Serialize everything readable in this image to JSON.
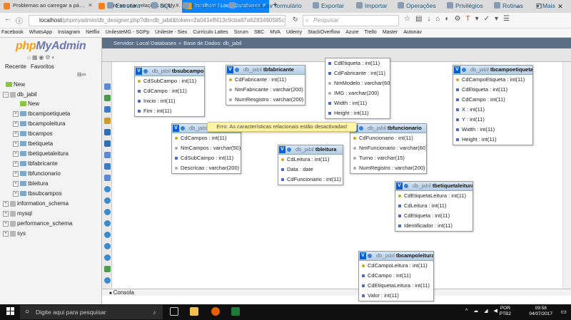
{
  "browser": {
    "tabs": [
      {
        "title": "Problemas ao carregar a pá…",
        "icon_color": "#f48024"
      },
      {
        "title": "Erro ao criar relações no My…",
        "icon_color": "#f48024"
      },
      {
        "title": "localhost / Local Databases",
        "icon_color": "#f0a30a"
      }
    ],
    "new_tab_label": "+",
    "window_controls": [
      "–",
      "❐",
      "✕"
    ],
    "url_host": "localhost",
    "url_rest": "/phpmyadmin/db_designer.php?db=db_jabil&token=2a041eff413c9cba87a6283490585c",
    "search_placeholder": "Pesquisar",
    "bookmarks": [
      "Facebook",
      "WhatsApp",
      "Instagram",
      "Netflix",
      "UnilesteMG - SGPp",
      "Unileste - Siex",
      "Currículo Lattes",
      "Scrum",
      "SBC",
      "MVA",
      "Udemy",
      "StackOverflow",
      "Azure",
      "Trello",
      "Master",
      "Autonav"
    ]
  },
  "sidebar": {
    "logo_php": "php",
    "logo_myadmin": "MyAdmin",
    "recent_label": "Recente",
    "favorites_label": "Favoritos",
    "new_label": "New",
    "db_name": "db_jabil",
    "db_new_label": "New",
    "tables": [
      "tbcampoetiqueta",
      "tbcampoleitura",
      "tbcampos",
      "tbetiqueta",
      "tbetiquetaleitura",
      "tbfabricante",
      "tbfuncionario",
      "tbleitura",
      "tbsubcampos"
    ],
    "other_dbs": [
      "information_schema",
      "mysql",
      "performance_schema",
      "sys"
    ]
  },
  "breadcrumb": {
    "server": "Servidor: Local Databases",
    "separator": "»",
    "database": "Base de Dados: db_jabil"
  },
  "menu_tabs": [
    "Estrutura",
    "SQL",
    "Pesquisar",
    "Pesquisa por formulário",
    "Exportar",
    "Importar",
    "Operações",
    "Privilégios",
    "Rotinas",
    "Mais"
  ],
  "error_message": "Erro: As características relacionais estão desactivadas!",
  "console_label": "Consola",
  "designer_tables": [
    {
      "db": "db_jabil",
      "name": "tbsubcampos",
      "cols": [
        [
          "key",
          "CdSubCampo : int(11)"
        ],
        [
          "int",
          "CdCampo : int(11)"
        ],
        [
          "int",
          "Inicio : int(11)"
        ],
        [
          "int",
          "Fim : int(11)"
        ]
      ]
    },
    {
      "db": "db_jabil",
      "name": "tbfabricante",
      "cols": [
        [
          "key",
          "CdFabricante : int(11)"
        ],
        [
          "str",
          "NmFabricante : varchar(200)"
        ],
        [
          "str",
          "NumResgistro : varchar(200)"
        ]
      ]
    },
    {
      "db": "",
      "name": "",
      "cols": [
        [
          "int",
          "CdEtiqueta : int(11)"
        ],
        [
          "int",
          "CdFabricante : int(11)"
        ],
        [
          "str",
          "NmModelo : varchar(60)"
        ],
        [
          "str",
          "IMG : varchar(200)"
        ],
        [
          "int",
          "Width : int(11)"
        ],
        [
          "int",
          "Height : int(11)"
        ]
      ]
    },
    {
      "db": "db_jabil",
      "name": "tbcampoetiqueta",
      "cols": [
        [
          "key",
          "CdCampoEtiqueta : int(11)"
        ],
        [
          "int",
          "CdEtiqueta : int(11)"
        ],
        [
          "int",
          "CdCampo : int(11)"
        ],
        [
          "int",
          "X : int(11)"
        ],
        [
          "int",
          "Y : int(11)"
        ],
        [
          "int",
          "Width : int(11)"
        ],
        [
          "int",
          "Height : int(11)"
        ]
      ]
    },
    {
      "db": "db_jabil",
      "name": "tbcampos",
      "cols": [
        [
          "key",
          "CdCampos : int(11)"
        ],
        [
          "str",
          "NmCampos : varchar(50)"
        ],
        [
          "int",
          "CdSubCampo : int(11)"
        ],
        [
          "str",
          "Descricao : varchar(200)"
        ]
      ]
    },
    {
      "db": "db_jabil",
      "name": "tbleitura",
      "cols": [
        [
          "key",
          "CdLeitura : int(11)"
        ],
        [
          "int",
          "Data : date"
        ],
        [
          "int",
          "CdFuncionario : int(11)"
        ]
      ]
    },
    {
      "db": "db_jabil",
      "name": "tbfuncionario",
      "cols": [
        [
          "key",
          "CdFuncionario : int(11)"
        ],
        [
          "str",
          "NmFuncionario : varchar(60)"
        ],
        [
          "str",
          "Turno : varchar(15)"
        ],
        [
          "str",
          "NumRegistro : varchar(200)"
        ]
      ]
    },
    {
      "db": "db_jabil",
      "name": "tbetiquetaleitura",
      "cols": [
        [
          "key",
          "CdEtiquetaLeitura : int(11)"
        ],
        [
          "int",
          "CdLeitura : int(11)"
        ],
        [
          "int",
          "CdEtiqueta : int(11)"
        ],
        [
          "int",
          "Identificador : int(11)"
        ]
      ]
    },
    {
      "db": "db_jabil",
      "name": "tbcampoleitura",
      "cols": [
        [
          "key",
          "CdCampoLeitura : int(11)"
        ],
        [
          "int",
          "CdCampo : int(11)"
        ],
        [
          "int",
          "CdEtiquetaLeitura : int(11)"
        ],
        [
          "int",
          "Valor : int(11)"
        ]
      ]
    }
  ],
  "taskbar": {
    "search_placeholder": "Digite aqui para pesquisar",
    "lang_top": "POR",
    "lang_bottom": "PTB2",
    "time": "09:58",
    "date": "04/07/2017"
  }
}
